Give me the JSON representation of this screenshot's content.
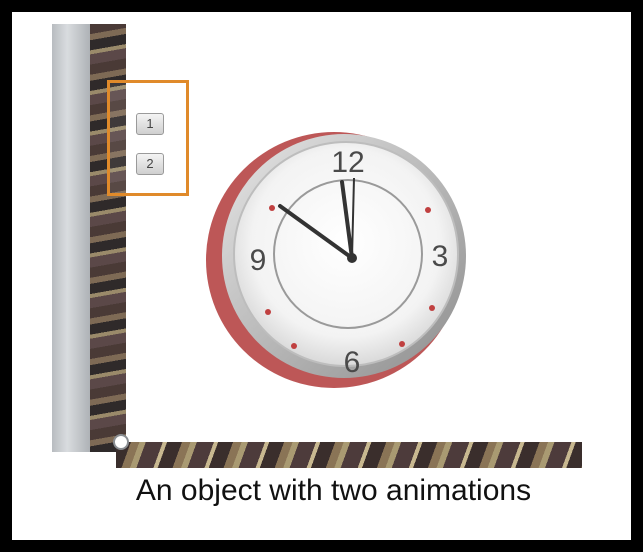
{
  "slide": {
    "animation_tags": [
      "1",
      "2"
    ],
    "clock": {
      "numerals": [
        "12",
        "3",
        "6",
        "9"
      ]
    },
    "caption": "An object with two animations"
  },
  "colors": {
    "highlight_box": "#e08a2a",
    "clock_rim_accent": "#b23a3a",
    "frame": "#000000"
  }
}
